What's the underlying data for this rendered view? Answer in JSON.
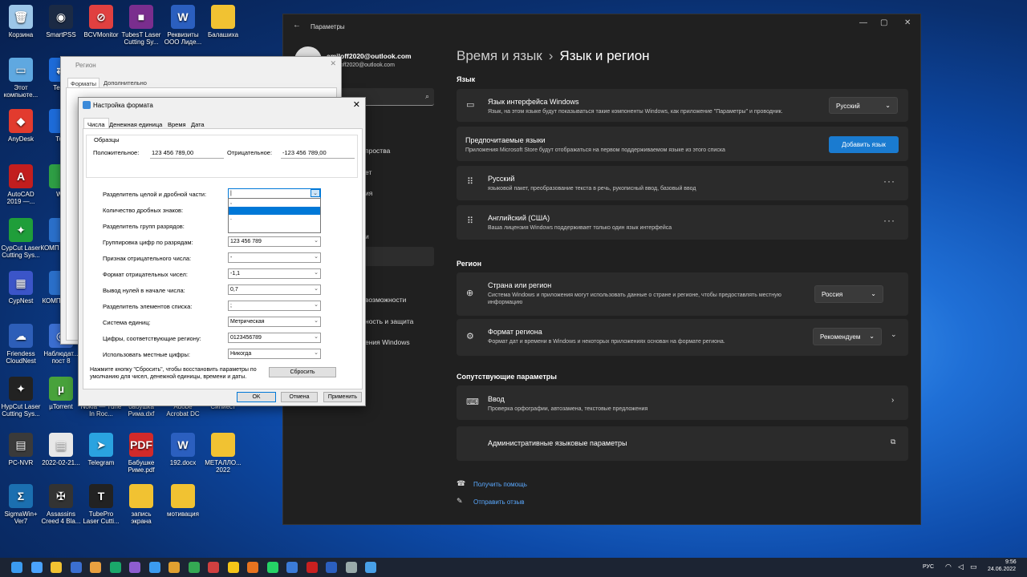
{
  "desktop_icons": [
    {
      "label": "Корзина",
      "color": "#9cc6e8",
      "glyph": "🗑"
    },
    {
      "label": "SmartPSS",
      "color": "#1b2a44",
      "glyph": "◉"
    },
    {
      "label": "BCVMonitor",
      "color": "#e04040",
      "glyph": "⊘"
    },
    {
      "label": "TubesT Laser Cutting Sy...",
      "color": "#7a2e8e",
      "glyph": "■"
    },
    {
      "label": "Реквизиты ООО Лиде...",
      "color": "#2b5fbf",
      "glyph": "W"
    },
    {
      "label": "Балашиха",
      "color": "#f1c232",
      "glyph": ""
    },
    {
      "label": "Этот компьюте...",
      "color": "#5fa8e0",
      "glyph": "▭"
    },
    {
      "label": "Team",
      "color": "#1d6bd8",
      "glyph": "⇄"
    },
    {
      "label": "AnyDesk",
      "color": "#e23b2e",
      "glyph": "◆"
    },
    {
      "label": "Tub",
      "color": "#1d6bd8",
      "glyph": ""
    },
    {
      "label": "AutoCAD 2019 —...",
      "color": "#c21e1e",
      "glyph": "A"
    },
    {
      "label": "We",
      "color": "#2e9e44",
      "glyph": ""
    },
    {
      "label": "CypCut Laser Cutting Sys...",
      "color": "#1f9e3a",
      "glyph": "✦"
    },
    {
      "label": "КОМП v20 У...",
      "color": "#2a6fc9",
      "glyph": ""
    },
    {
      "label": "CypNest",
      "color": "#3b55c8",
      "glyph": "▦"
    },
    {
      "label": "КОМП Viewe",
      "color": "#2a6fc9",
      "glyph": ""
    },
    {
      "label": "Friendess CloudNest",
      "color": "#2d5eb8",
      "glyph": "☁"
    },
    {
      "label": "Наблюдат... пост 8",
      "color": "#3b6ed0",
      "glyph": "◎"
    },
    {
      "label": "HypCut Laser Cutting Sys...",
      "color": "#222",
      "glyph": "✦"
    },
    {
      "label": "µTorrent",
      "color": "#48a23b",
      "glyph": "µ"
    },
    {
      "label": "Nokia — Tune In Roc...",
      "color": "",
      "glyph": ""
    },
    {
      "label": "бабушка Рима.dxf",
      "color": "",
      "glyph": ""
    },
    {
      "label": "Adobe Acrobat DC",
      "color": "",
      "glyph": ""
    },
    {
      "label": "Сипиест",
      "color": "",
      "glyph": ""
    },
    {
      "label": "PC-NVR",
      "color": "#3a3a3a",
      "glyph": "▤"
    },
    {
      "label": "2022-02-21...",
      "color": "#e8e8e8",
      "glyph": "▦"
    },
    {
      "label": "Telegram",
      "color": "#2aa3e0",
      "glyph": "➤"
    },
    {
      "label": "Бабушке Риме.pdf",
      "color": "#d22a2a",
      "glyph": "PDF"
    },
    {
      "label": "192.docx",
      "color": "#2b5fbf",
      "glyph": "W"
    },
    {
      "label": "МЕТАЛЛО... 2022",
      "color": "#f1c232",
      "glyph": ""
    },
    {
      "label": "SigmaWin+ Ver7",
      "color": "#1b6fb0",
      "glyph": "Σ"
    },
    {
      "label": "Assassins Creed 4 Bla...",
      "color": "#333",
      "glyph": "✠"
    },
    {
      "label": "TubePro Laser Cutti...",
      "color": "#222",
      "glyph": "T"
    },
    {
      "label": "запись экрана",
      "color": "#f1c232",
      "glyph": ""
    },
    {
      "label": "мотивация",
      "color": "#f1c232",
      "glyph": ""
    }
  ],
  "settings": {
    "window_title": "Параметры",
    "user_name": "amiloff2020@outlook.com",
    "user_email": "amiloff2020@outlook.com",
    "breadcrumb_parent": "Время и язык",
    "breadcrumb_sep": "›",
    "breadcrumb_current": "Язык и регион",
    "sidebar_peek": [
      "проства",
      "ет",
      "ия",
      "и",
      "",
      "возможности",
      "ность и защита",
      "ения Windows"
    ],
    "language_section": "Язык",
    "display_lang_title": "Язык интерфейса Windows",
    "display_lang_sub": "Язык, на этом языке будут показываться такие компоненты Windows, как приложение \"Параметры\" и проводник.",
    "display_lang_value": "Русский",
    "pref_title": "Предпочитаемые языки",
    "pref_sub": "Приложения Microsoft Store будут отображаться на первом поддерживаемом языке из этого списка",
    "add_lang_button": "Добавить язык",
    "lang1_title": "Русский",
    "lang1_sub": "языковой пакет, преобразование текста в речь, рукописный ввод, базовый ввод",
    "lang2_title": "Английский (США)",
    "lang2_sub": "Ваша лицензия Windows поддерживает только один язык интерфейса",
    "region_section": "Регион",
    "country_title": "Страна или регион",
    "country_sub": "Система Windows и приложения могут использовать данные о стране и регионе, чтобы предоставлять местную информацию",
    "country_value": "Россия",
    "format_title": "Формат региона",
    "format_sub": "Формат дат и времени в Windows и некоторых приложениях основан на формате региона.",
    "format_value": "Рекомендуем",
    "related_section": "Сопутствующие параметры",
    "input_title": "Ввод",
    "input_sub": "Проверка орфографии, автозамена, текстовые предложения",
    "admin_title": "Административные языковые параметры",
    "help_link": "Получить помощь",
    "feedback_link": "Отправить отзыв"
  },
  "region_dialog": {
    "title": "Регион",
    "tabs": [
      "Форматы",
      "Дополнительно"
    ]
  },
  "format_dialog": {
    "title": "Настройка формата",
    "tabs": [
      "Числа",
      "Денежная единица",
      "Время",
      "Дата"
    ],
    "samples_label": "Образцы",
    "positive_label": "Положительное:",
    "positive_value": "123 456 789,00",
    "negative_label": "Отрицательное:",
    "negative_value": "-123 456 789,00",
    "rows": [
      {
        "label": "Разделитель целой и дробной части:",
        "value": ""
      },
      {
        "label": "Количество дробных знаков:",
        "value": ""
      },
      {
        "label": "Разделитель групп разрядов:",
        "value": ""
      },
      {
        "label": "Группировка цифр по разрядам:",
        "value": "123 456 789"
      },
      {
        "label": "Признак отрицательного числа:",
        "value": "-"
      },
      {
        "label": "Формат отрицательных чисел:",
        "value": "-1,1"
      },
      {
        "label": "Вывод нулей в начале числа:",
        "value": "0,7"
      },
      {
        "label": "Разделитель элементов списка:",
        "value": ";"
      },
      {
        "label": "Система единиц:",
        "value": "Метрическая"
      },
      {
        "label": "Цифры, соответствующие региону:",
        "value": "0123456789"
      },
      {
        "label": "Использовать местные цифры:",
        "value": "Никогда"
      }
    ],
    "decimal_combo_value": "|",
    "dropdown_options": [
      ",",
      "",
      ".",
      ""
    ],
    "reset_text": "Нажмите кнопку \"Сбросить\", чтобы восстановить параметры по умолчанию для чисел, денежной единицы, времени и даты.",
    "reset_button": "Сбросить",
    "ok_button": "OK",
    "cancel_button": "Отмена",
    "apply_button": "Применить"
  },
  "taskbar": {
    "lang": "РУС",
    "time": "9:56",
    "date": "24.06.2022"
  }
}
